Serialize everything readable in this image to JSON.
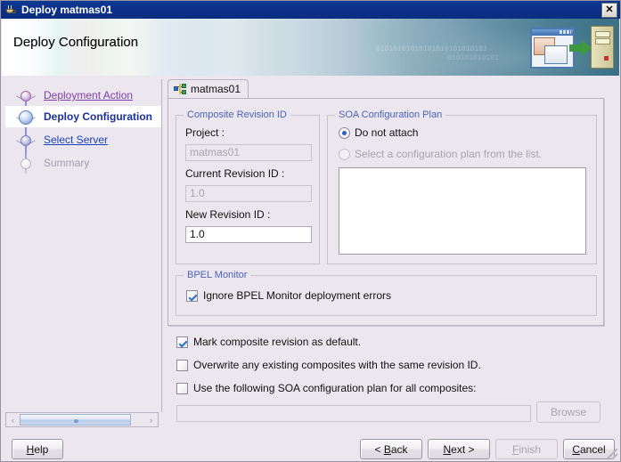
{
  "window": {
    "title": "Deploy matmas01",
    "icon": "java-cup-icon",
    "close_label": "✕"
  },
  "header": {
    "title": "Deploy Configuration",
    "binary_art_1": "01010101010101010101010101",
    "binary_art_2": "010101010101"
  },
  "sidebar": {
    "steps": [
      {
        "label": "Deployment Action",
        "state": "visited"
      },
      {
        "label": "Deploy Configuration",
        "state": "current"
      },
      {
        "label": "Select Server",
        "state": "link"
      },
      {
        "label": "Summary",
        "state": "disabled"
      }
    ],
    "scrollbar": {
      "left_arrow": "‹",
      "right_arrow": "›"
    }
  },
  "main": {
    "tab": {
      "label": "matmas01",
      "icon": "composite-icon"
    },
    "composite_revision": {
      "group_title": "Composite Revision ID",
      "project_label": "Project :",
      "project_value": "matmas01",
      "current_revision_label": "Current Revision ID :",
      "current_revision_value": "1.0",
      "new_revision_label": "New Revision ID :",
      "new_revision_value": "1.0"
    },
    "soa_plan": {
      "group_title": "SOA Configuration Plan",
      "option_do_not_attach": "Do not attach",
      "option_select_plan": "Select a configuration plan from the list.",
      "selected": "do_not_attach",
      "list_items": []
    },
    "bpel_monitor": {
      "group_title": "BPEL Monitor",
      "ignore_errors_label": "Ignore BPEL Monitor deployment errors",
      "ignore_errors_checked": true
    },
    "options": [
      {
        "label": "Mark composite revision as default.",
        "checked": true
      },
      {
        "label": "Overwrite any existing composites with the same revision ID.",
        "checked": false
      },
      {
        "label": "Use the following SOA configuration plan for all composites:",
        "checked": false
      }
    ],
    "plan_path_value": "",
    "browse_label": "Browse"
  },
  "buttons": {
    "help": {
      "prefix": "",
      "accel": "H",
      "suffix": "elp"
    },
    "back": {
      "prefix": "< ",
      "accel": "B",
      "suffix": "ack"
    },
    "next": {
      "prefix": "",
      "accel": "N",
      "suffix": "ext >"
    },
    "finish": {
      "prefix": "",
      "accel": "F",
      "suffix": "inish"
    },
    "cancel": {
      "prefix": "",
      "accel": "C",
      "suffix": "ancel"
    }
  },
  "colors": {
    "titlebar": "#0a3a8f",
    "dialog_bg": "#ece7ee",
    "group_title": "#4a63b8",
    "current_step": "#1a2f9e",
    "visited_link": "#7a3fa8",
    "link": "#1a3fc0",
    "disabled_text": "#a9a3af"
  }
}
